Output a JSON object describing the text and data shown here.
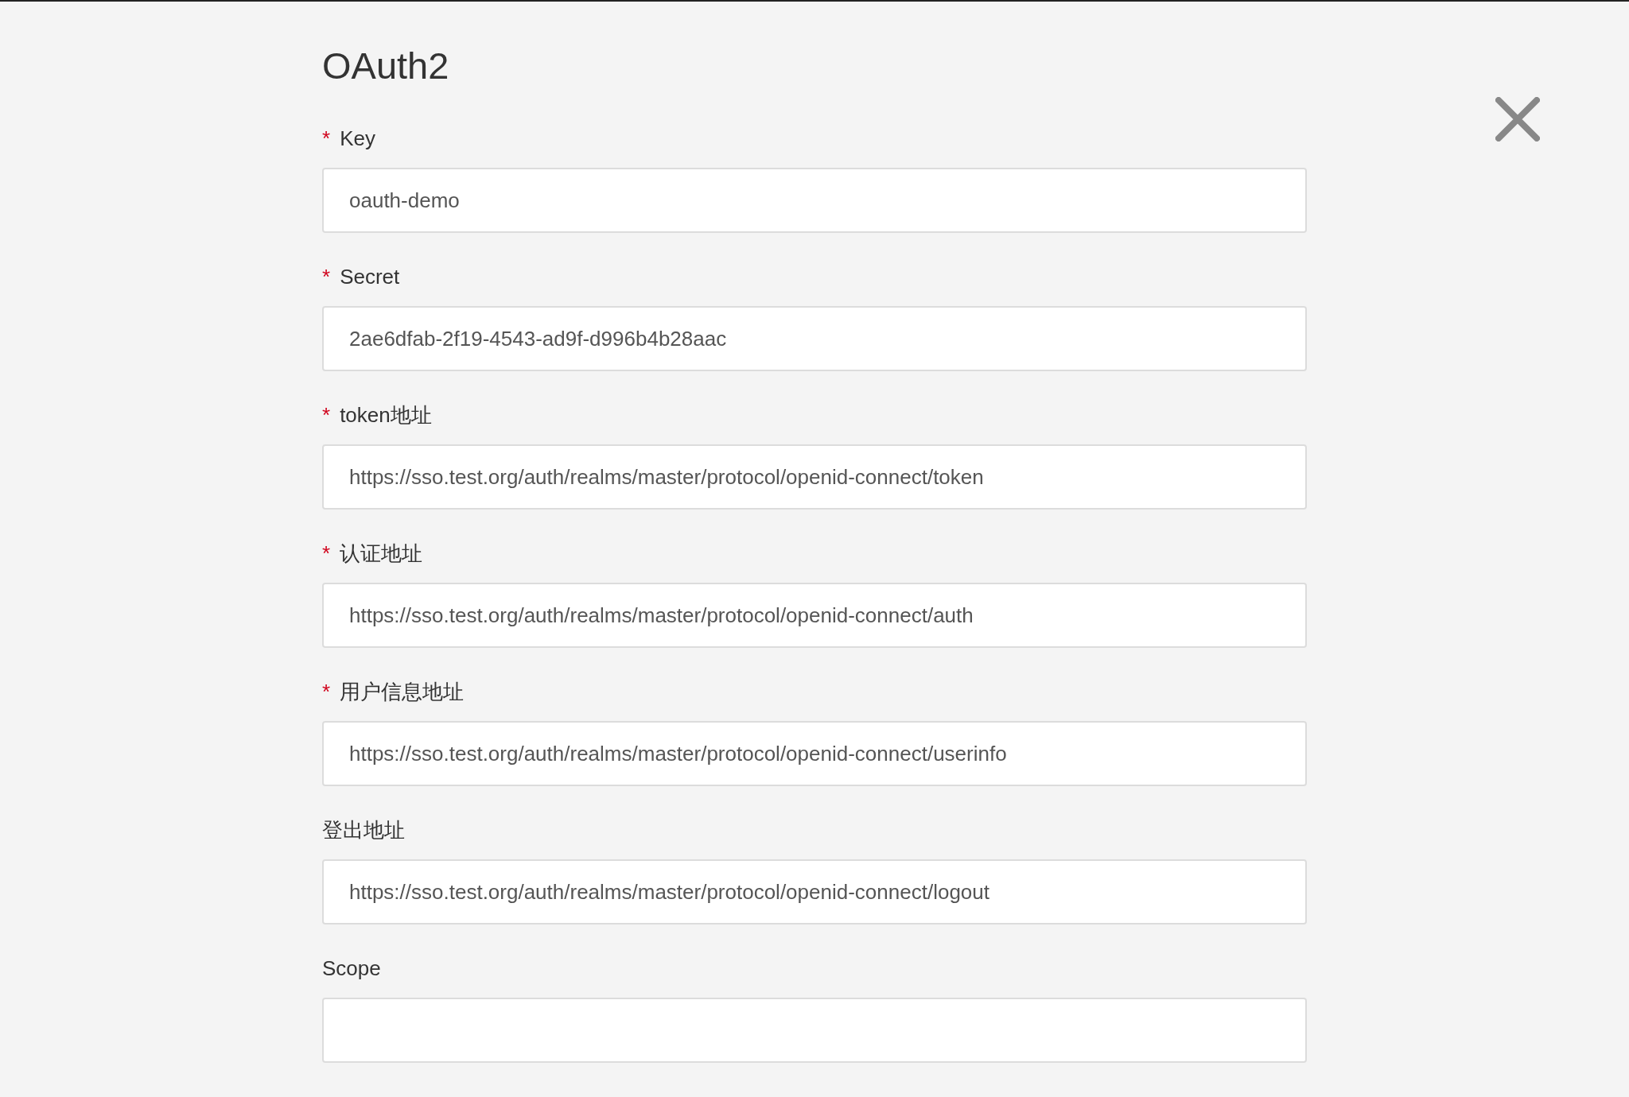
{
  "title": "OAuth2",
  "fields": [
    {
      "marker": "*",
      "label": "Key",
      "value": "oauth-demo"
    },
    {
      "marker": "*",
      "label": "Secret",
      "value": "2ae6dfab-2f19-4543-ad9f-d996b4b28aac"
    },
    {
      "marker": "*",
      "label": "token地址",
      "value": "https://sso.test.org/auth/realms/master/protocol/openid-connect/token"
    },
    {
      "marker": "*",
      "label": "认证地址",
      "value": "https://sso.test.org/auth/realms/master/protocol/openid-connect/auth"
    },
    {
      "marker": "*",
      "label": "用户信息地址",
      "value": "https://sso.test.org/auth/realms/master/protocol/openid-connect/userinfo"
    },
    {
      "label": "登出地址",
      "value": "https://sso.test.org/auth/realms/master/protocol/openid-connect/logout"
    },
    {
      "label": "Scope"
    }
  ]
}
